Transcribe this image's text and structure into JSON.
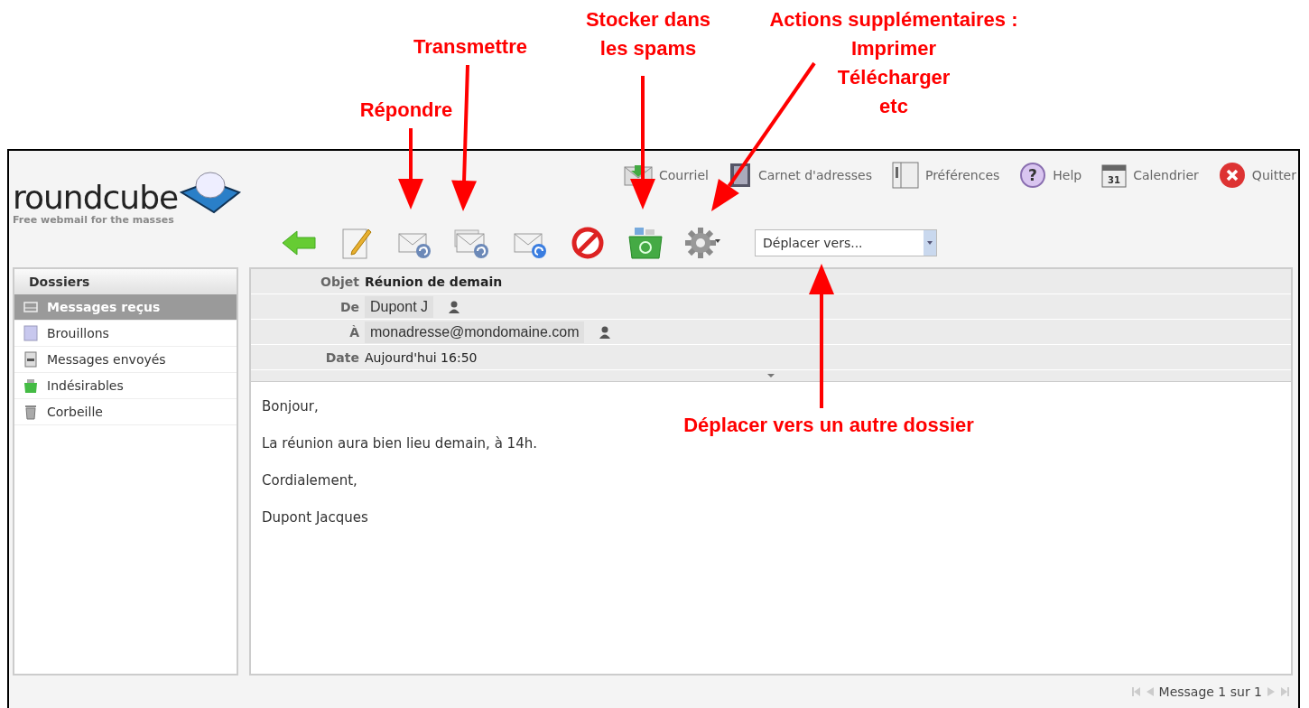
{
  "annotations": [
    {
      "lines": [
        "Répondre"
      ]
    },
    {
      "lines": [
        "Transmettre"
      ]
    },
    {
      "lines": [
        "Stocker dans",
        "les spams"
      ]
    },
    {
      "lines": [
        "Actions supplémentaires :",
        "Imprimer",
        "Télécharger",
        "etc"
      ]
    },
    {
      "lines": [
        "Déplacer vers un autre dossier"
      ]
    }
  ],
  "logo": {
    "name": "roundcube",
    "tagline": "Free webmail for the masses"
  },
  "top_nav": [
    {
      "label": "Courriel",
      "kind": "mail"
    },
    {
      "label": "Carnet d'adresses",
      "kind": "addressbook"
    },
    {
      "label": "Préférences",
      "kind": "settings"
    },
    {
      "label": "Help",
      "kind": "help",
      "icon_text": "?"
    },
    {
      "label": "Calendrier",
      "kind": "calendar",
      "icon_text": "31"
    },
    {
      "label": "Quitter",
      "kind": "logout"
    }
  ],
  "toolbar": {
    "tools": [
      {
        "kind": "back"
      },
      {
        "kind": "compose"
      },
      {
        "kind": "reply"
      },
      {
        "kind": "reply-all"
      },
      {
        "kind": "forward"
      },
      {
        "kind": "delete"
      },
      {
        "kind": "spam"
      },
      {
        "kind": "more"
      }
    ],
    "move_select": {
      "value": "Déplacer vers..."
    }
  },
  "folders": {
    "title": "Dossiers",
    "items": [
      {
        "label": "Messages reçus",
        "kind": "inbox",
        "selected": true
      },
      {
        "label": "Brouillons",
        "kind": "drafts",
        "selected": false
      },
      {
        "label": "Messages envoyés",
        "kind": "sent",
        "selected": false
      },
      {
        "label": "Indésirables",
        "kind": "junk",
        "selected": false
      },
      {
        "label": "Corbeille",
        "kind": "trash",
        "selected": false
      }
    ]
  },
  "message": {
    "headers": [
      {
        "label": "Objet",
        "value": "Réunion de demain",
        "kind": "subject"
      },
      {
        "label": "De",
        "value": "Dupont J",
        "kind": "contact"
      },
      {
        "label": "À",
        "value": "monadresse@mondomaine.com",
        "kind": "contact"
      },
      {
        "label": "Date",
        "value": "Aujourd'hui 16:50",
        "kind": "plain"
      }
    ],
    "body": [
      "Bonjour,",
      "La réunion aura bien lieu demain, à 14h.",
      "Cordialement,",
      "Dupont Jacques"
    ]
  },
  "pager": {
    "text": "Message 1 sur 1"
  }
}
